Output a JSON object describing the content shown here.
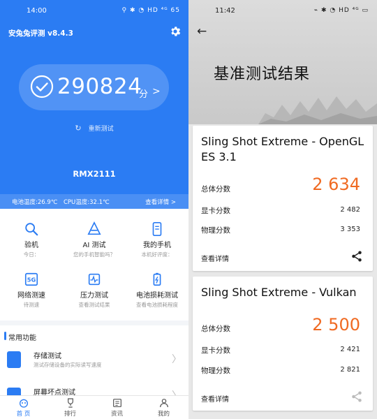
{
  "left": {
    "status": {
      "time": "14:00",
      "icons": "⚲  ✱ ◔ HD ⁴ᴳ 65"
    },
    "app_title": "安兔兔评测 v8.4.3",
    "score": {
      "value": "290824",
      "unit": "分",
      "chevron": ">"
    },
    "retest_label": "重新测试",
    "device_name": "RMX2111",
    "temps": {
      "battery": "电池温度:26.9℃",
      "cpu": "CPU温度:32.1℃",
      "details": "查看详情 >"
    },
    "features": [
      {
        "label": "验机",
        "sub": "今日："
      },
      {
        "label": "AI 测试",
        "sub": "您的手机智能吗？"
      },
      {
        "label": "我的手机",
        "sub": "本机好评度："
      },
      {
        "label": "网络测速",
        "sub": "待测速"
      },
      {
        "label": "压力测试",
        "sub": "查看测试结果"
      },
      {
        "label": "电池损耗测试",
        "sub": "查看电池损耗程度"
      }
    ],
    "section_title": "常用功能",
    "common": [
      {
        "title": "存储测试",
        "sub": "测试存储设备的实际读写速度"
      },
      {
        "title": "屏幕坏点测试",
        "sub": ""
      }
    ],
    "nav": [
      "首 页",
      "排行",
      "资讯",
      "我的"
    ],
    "accent": "#2b7cf3"
  },
  "right": {
    "status": {
      "time": "11:42",
      "icons": "⌁ ✱ ◔ HD ⁴ᴳ ▭"
    },
    "title": "基准测试结果",
    "cards": [
      {
        "title": "Sling Shot Extreme - OpenGL ES 3.1",
        "total_label": "总体分数",
        "total": "2 634",
        "gpu_label": "显卡分数",
        "gpu": "2 482",
        "physics_label": "物理分数",
        "physics": "3 353",
        "details": "查看详情"
      },
      {
        "title": "Sling Shot Extreme - Vulkan",
        "total_label": "总体分数",
        "total": "2 500",
        "gpu_label": "显卡分数",
        "gpu": "2 421",
        "physics_label": "物理分数",
        "physics": "2 821",
        "details": "查看详情"
      }
    ],
    "accent": "#f06a22"
  }
}
